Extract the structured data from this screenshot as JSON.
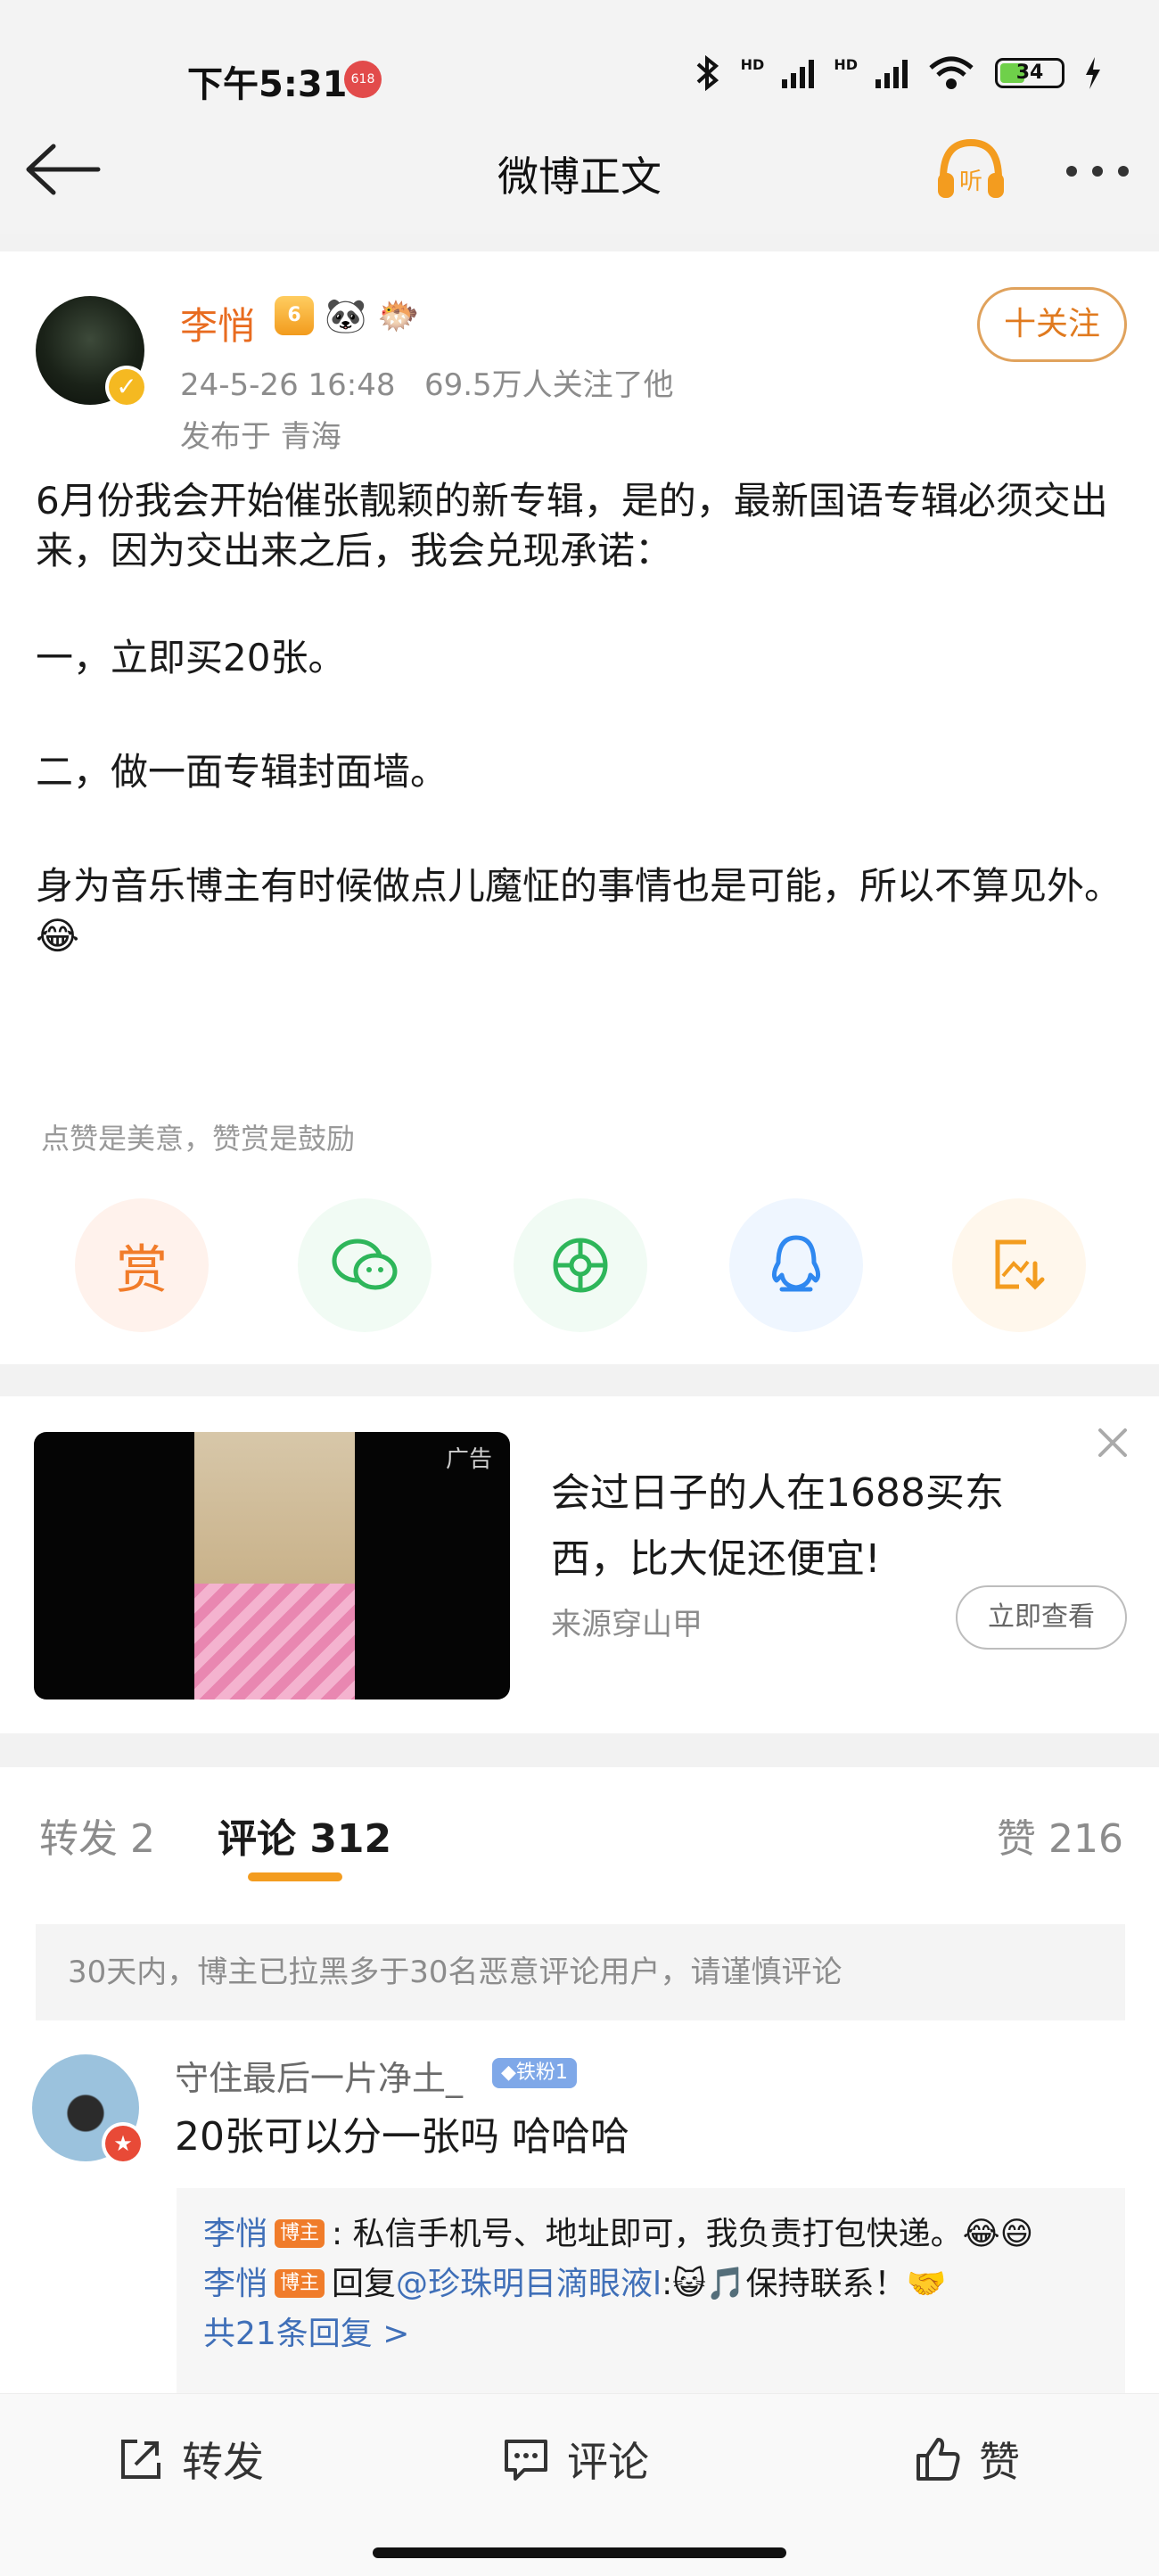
{
  "status_bar": {
    "time": "下午5:31",
    "badge": "618",
    "hd1": "HD",
    "hd2": "HD",
    "battery": "34"
  },
  "nav": {
    "title": "微博正文",
    "listen_label": "听"
  },
  "post": {
    "author": "李悄",
    "crown_level": "6",
    "date": "24-5-26 16:48",
    "followers": "69.5万人关注了他",
    "location": "发布于 青海",
    "follow_label": "十关注",
    "paragraphs": [
      "6月份我会开始催张靓颖的新专辑，是的，最新国语专辑必须交出来，因为交出来之后，我会兑现承诺：",
      "",
      "一，立即买20张。",
      "",
      "二，做一面专辑封面墙。",
      "",
      "身为音乐博主有时候做点儿魔怔的事情也是可能，所以不算见外。😂"
    ],
    "tip": "点赞是美意，赞赏是鼓励",
    "reward_label": "赏"
  },
  "ad": {
    "label": "广告",
    "title": "会过日子的人在1688买东西，比大促还便宜!",
    "source": "来源穿山甲",
    "button": "立即查看"
  },
  "comments": {
    "tabs": {
      "repost": "转发 2",
      "comment": "评论 312",
      "like": "赞 216"
    },
    "notice": "30天内，博主已拉黑多于30名恶意评论用户，请谨慎评论",
    "item": {
      "user": "守住最后一片净土_",
      "fan_badge": "◆铁粉1",
      "text": "20张可以分一张吗 哈哈哈",
      "replies": [
        {
          "name": "李悄",
          "tag": "博主",
          "text": ": 私信手机号、地址即可，我负责打包快递。😂😄"
        },
        {
          "name": "李悄",
          "tag": "博主",
          "prefix": "回复",
          "mention": "@珍珠明目滴眼液l",
          "text": ":😺🎵保持联系！🤝"
        }
      ],
      "more": "共21条回复 >"
    }
  },
  "bottom_bar": {
    "repost": "转发",
    "comment": "评论",
    "like": "赞"
  },
  "colors": {
    "accent": "#e86b1f",
    "link": "#3f6fb8",
    "tab_underline": "#f39c1f"
  },
  "icons": [
    "back-arrow-icon",
    "listen-icon",
    "more-icon",
    "verified-icon",
    "wechat-icon",
    "moments-icon",
    "qq-icon",
    "save-image-icon",
    "close-icon",
    "repost-icon",
    "comment-icon",
    "like-icon"
  ]
}
